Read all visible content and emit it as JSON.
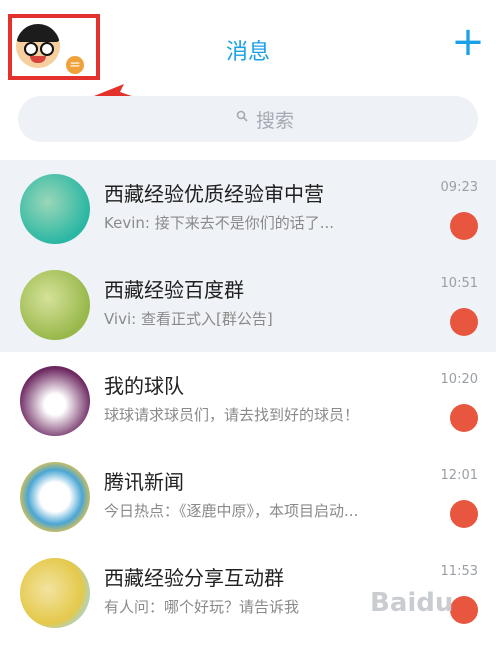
{
  "header": {
    "title": "消息",
    "add_label": "+",
    "avatar_badge": "="
  },
  "search": {
    "placeholder": "搜索"
  },
  "chats": [
    {
      "title": "西藏经验优质经验审中营",
      "subtitle": "Kevin: 接下来去不是你们的话了...",
      "time": "09:23",
      "avatar_color": "#2bb7a3"
    },
    {
      "title": "西藏经验百度群",
      "subtitle": "Vivi: 查看正式入[群公告]",
      "time": "10:51",
      "avatar_color": "#98b84a"
    },
    {
      "title": "我的球队",
      "subtitle": "球球请求球员们，请去找到好的球员！",
      "time": "10:20",
      "avatar_color": "#6c2860"
    },
    {
      "title": "腾讯新闻",
      "subtitle": "今日热点：《逐鹿中原》，本项目启动...",
      "time": "12:01",
      "avatar_color": "#4aa6d4"
    },
    {
      "title": "西藏经验分享互动群",
      "subtitle": "有人问：哪个好玩？请告诉我",
      "time": "11:53",
      "avatar_color": "#e4c94b"
    }
  ],
  "watermark": "Baidu"
}
